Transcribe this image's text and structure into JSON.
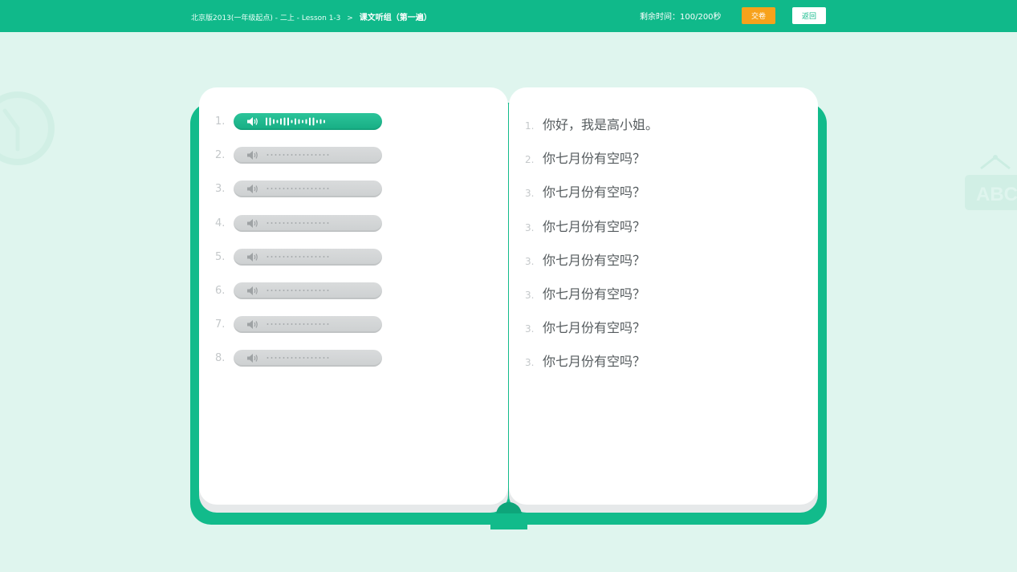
{
  "header": {
    "breadcrumb_path": "北京版2013(一年级起点) - 二上 - Lesson 1-3",
    "breadcrumb_sep": ">",
    "breadcrumb_current": "课文听组（第一遍）",
    "timer": "剩余时间：100/200秒",
    "submit_label": "交卷",
    "back_label": "返回"
  },
  "decorations": {
    "abc_label": "ABC"
  },
  "audio_items": [
    {
      "num": "1.",
      "state": "playing"
    },
    {
      "num": "2.",
      "state": "idle"
    },
    {
      "num": "3.",
      "state": "idle"
    },
    {
      "num": "4.",
      "state": "idle"
    },
    {
      "num": "5.",
      "state": "idle"
    },
    {
      "num": "6.",
      "state": "idle"
    },
    {
      "num": "7.",
      "state": "idle"
    },
    {
      "num": "8.",
      "state": "idle"
    }
  ],
  "sentences": [
    {
      "num": "1.",
      "text": "你好，我是高小姐。"
    },
    {
      "num": "2.",
      "text": "你七月份有空吗？"
    },
    {
      "num": "3.",
      "text": "你七月份有空吗？"
    },
    {
      "num": "3.",
      "text": "你七月份有空吗？"
    },
    {
      "num": "3.",
      "text": "你七月份有空吗？"
    },
    {
      "num": "3.",
      "text": "你七月份有空吗？"
    },
    {
      "num": "3.",
      "text": "你七月份有空吗？"
    },
    {
      "num": "3.",
      "text": "你七月份有空吗？"
    }
  ],
  "colors": {
    "brand": "#10b98a",
    "accent": "#f7a21b",
    "background": "#dff5ee"
  }
}
